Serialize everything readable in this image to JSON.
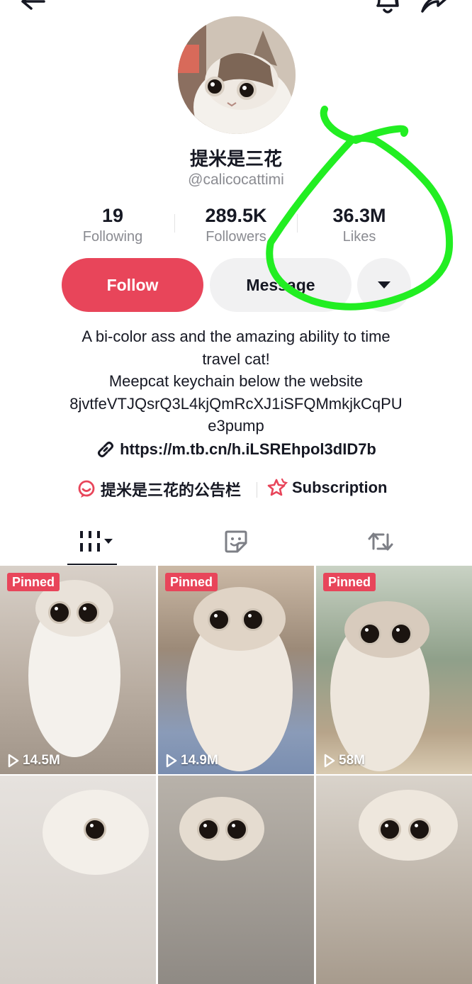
{
  "header": {
    "back_icon": "arrow-left-icon",
    "bell_icon": "bell-icon",
    "share_icon": "share-arrow-icon"
  },
  "profile": {
    "display_name": "提米是三花",
    "handle": "@calicocattimi"
  },
  "stats": [
    {
      "value": "19",
      "label": "Following"
    },
    {
      "value": "289.5K",
      "label": "Followers"
    },
    {
      "value": "36.3M",
      "label": "Likes"
    }
  ],
  "actions": {
    "follow_label": "Follow",
    "message_label": "Message",
    "more_icon": "caret-down-icon"
  },
  "bio": {
    "lines": [
      "A bi-color ass and the amazing ability to time",
      "travel cat!",
      "Meepcat keychain below the website",
      "8jvtfeVTJQsrQ3L4kjQmRcXJ1iSFQMmkjkCqPU",
      "e3pump"
    ],
    "link": "https://m.tb.cn/h.iLSREhpol3dID7b"
  },
  "chips": [
    {
      "label": "提米是三花的公告栏",
      "icon": "bulletin-icon"
    },
    {
      "label": "Subscription",
      "icon": "subscription-star-icon"
    }
  ],
  "tabs": [
    {
      "name": "videos",
      "icon": "grid-icon"
    },
    {
      "name": "favorites",
      "icon": "sticker-icon"
    },
    {
      "name": "reposts",
      "icon": "repost-icon"
    }
  ],
  "videos": [
    {
      "pinned_label": "Pinned",
      "views": "14.5M"
    },
    {
      "pinned_label": "Pinned",
      "views": "14.9M"
    },
    {
      "pinned_label": "Pinned",
      "views": "58M"
    },
    {
      "pinned_label": "",
      "views": ""
    },
    {
      "pinned_label": "",
      "views": ""
    },
    {
      "pinned_label": "",
      "views": ""
    }
  ],
  "colors": {
    "brand": "#e8455a",
    "annotation": "#22ee22",
    "text": "#161823",
    "muted": "#8a8b91"
  }
}
